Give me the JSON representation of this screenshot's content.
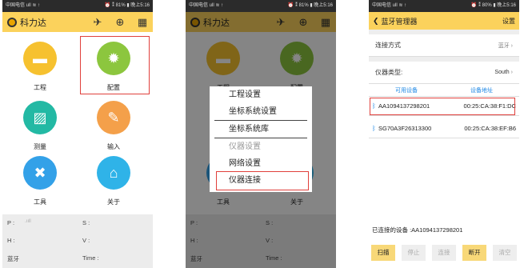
{
  "status": {
    "carrier": "中国电信 ull ≋ ↑",
    "right": "⏰ ⁑ 81% ▮ 晚上5:16",
    "right3": "⏰ ⁑ 80% ▮ 晚上5:16"
  },
  "app": {
    "title": "科力达",
    "icons": [
      "satellite-icon",
      "gps-antenna-icon",
      "calculator-icon"
    ]
  },
  "tiles": [
    {
      "label": "工程",
      "icon": "folder-icon",
      "glyph": "▬",
      "color": "#f6c12f"
    },
    {
      "label": "配置",
      "icon": "gear-icon",
      "glyph": "✹",
      "color": "#8cc63e"
    },
    {
      "label": "测量",
      "icon": "ruler-icon",
      "glyph": "▨",
      "color": "#23b9a4"
    },
    {
      "label": "输入",
      "icon": "edit-icon",
      "glyph": "✎",
      "color": "#f4a04a"
    },
    {
      "label": "工具",
      "icon": "tools-icon",
      "glyph": "✖",
      "color": "#33a1e8"
    },
    {
      "label": "关于",
      "icon": "store-icon",
      "glyph": "⌂",
      "color": "#2fb3e8"
    }
  ],
  "info": {
    "p_label": "P :",
    "s_label": "S :",
    "h_label": "H :",
    "v_label": "V :",
    "link_label": "蓝牙",
    "time_label": "Time :"
  },
  "menu": {
    "items": [
      {
        "label": "工程设置",
        "disabled": false
      },
      {
        "label": "坐标系统设置",
        "disabled": false
      },
      {
        "label": "坐标系统库",
        "disabled": false
      },
      {
        "label": "仪器设置",
        "disabled": true
      },
      {
        "label": "网络设置",
        "disabled": false
      },
      {
        "label": "仪器连接",
        "disabled": false
      }
    ]
  },
  "bluetooth": {
    "title": "蓝牙管理器",
    "settings": "设置",
    "conn_label": "连接方式",
    "conn_value": "蓝牙",
    "type_label": "仪器类型:",
    "type_value": "South",
    "col_device": "可用设备",
    "col_address": "设备地址",
    "devices": [
      {
        "name": "AA1094137298201",
        "address": "00:25:CA:38:F1:DC"
      },
      {
        "name": "SG70A3F26313300",
        "address": "00:25:CA:38:EF:B6"
      }
    ],
    "connected": "已连接的设备 :AA1094137298201",
    "buttons": [
      {
        "label": "扫描",
        "enabled": true
      },
      {
        "label": "停止",
        "enabled": false
      },
      {
        "label": "连接",
        "enabled": false
      },
      {
        "label": "断开",
        "enabled": true
      },
      {
        "label": "清空",
        "enabled": false
      }
    ]
  },
  "colors": {
    "accent": "#fbd25c",
    "highlight": "#e0403c",
    "link": "#1e88e5"
  }
}
